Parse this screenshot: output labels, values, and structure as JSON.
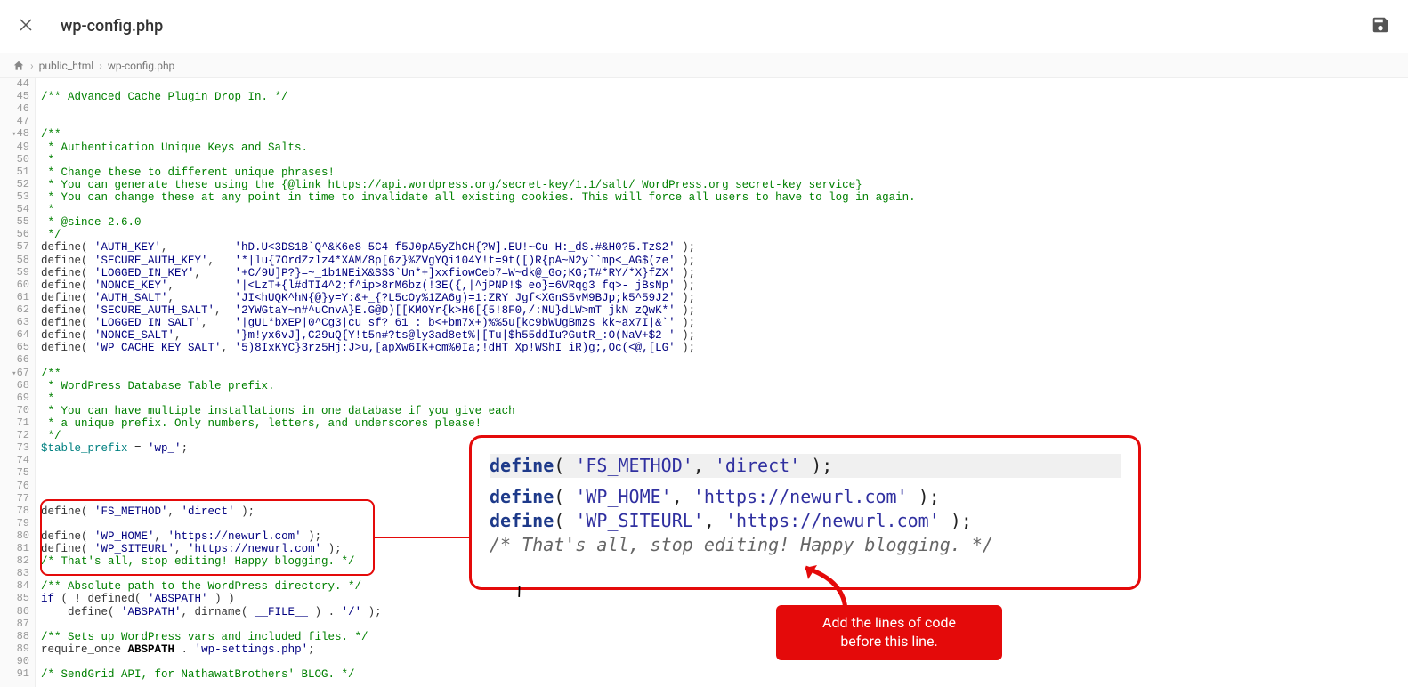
{
  "header": {
    "filename": "wp-config.php"
  },
  "breadcrumb": {
    "parts": [
      "public_html",
      "wp-config.php"
    ]
  },
  "first_line": 44,
  "code_lines": [
    {
      "type": "blank",
      "text": ""
    },
    {
      "type": "cm",
      "text": "/** Advanced Cache Plugin Drop In. */"
    },
    {
      "type": "blank",
      "text": ""
    },
    {
      "type": "blank",
      "text": ""
    },
    {
      "type": "cm",
      "text": "/**",
      "fold": true
    },
    {
      "type": "cm",
      "text": " * Authentication Unique Keys and Salts."
    },
    {
      "type": "cm",
      "text": " *"
    },
    {
      "type": "cm",
      "text": " * Change these to different unique phrases!"
    },
    {
      "type": "cm",
      "text": " * You can generate these using the {@link https://api.wordpress.org/secret-key/1.1/salt/ WordPress.org secret-key service}"
    },
    {
      "type": "cm",
      "text": " * You can change these at any point in time to invalidate all existing cookies. This will force all users to have to log in again."
    },
    {
      "type": "cm",
      "text": " *"
    },
    {
      "type": "cm",
      "text": " * @since 2.6.0"
    },
    {
      "type": "cm",
      "text": " */"
    },
    {
      "type": "def",
      "name": "AUTH_KEY",
      "pad": "         ",
      "val": "hD.U<3DS1B`Q^&K6e8-5C4 f5J0pA5yZhCH{?W].EU!~Cu H:_dS.#&H0?5.TzS2"
    },
    {
      "type": "def",
      "name": "SECURE_AUTH_KEY",
      "pad": "  ",
      "val": "*|lu{7OrdZzlz4*XAM/8p[6z}%ZVgYQi104Y!t=9t([)R{pA~N2y``mp<_AG$(ze"
    },
    {
      "type": "def",
      "name": "LOGGED_IN_KEY",
      "pad": "    ",
      "val": "+C/9U]P?}=~_1b1NEiX&SSS`Un*+]xxfiowCeb7=W~dk@_Go;KG;T#*RY/*X}fZX"
    },
    {
      "type": "def",
      "name": "NONCE_KEY",
      "pad": "        ",
      "val": "|<LzT+{l#dTI4^2;f^ip>8rM6bz(!3E({,|^jPNP!$ eo}=6VRqg3 fq>- jBsNp"
    },
    {
      "type": "def",
      "name": "AUTH_SALT",
      "pad": "        ",
      "val": "JI<hUQK^hN{@}y=Y:&+_{?L5cOy%1ZA6g)=1:ZRY Jgf<XGnS5vM9BJp;k5^59J2"
    },
    {
      "type": "def",
      "name": "SECURE_AUTH_SALT",
      "pad": " ",
      "val": "2YWGtaY~n#^uCnvA}E.G@D)[[KMOYr{k>H6[{5!8F0,/:NU}dLW>mT jkN zQwK*"
    },
    {
      "type": "def",
      "name": "LOGGED_IN_SALT",
      "pad": "   ",
      "val": "|gUL*bXEP|0^Cg3|cu sf?_61_: b<+bm7x+)%%5u[kc9bWUgBmzs_kk~ax7I|&`"
    },
    {
      "type": "def",
      "name": "NONCE_SALT",
      "pad": "       ",
      "val": "}m!yx6vJ],C29uQ{Y!t5n#?ts@ly3ad8et%|[Tu|$h55ddIu?GutR_:O(NaV+$2-"
    },
    {
      "type": "def",
      "name": "WP_CACHE_KEY_SALT",
      "pad": "",
      "val": "5)8IxKYC}3rz5Hj:J>u,[apXw6IK+cm%0Ia;!dHT Xp!WShI iR)g;,Oc(<@,[LG"
    },
    {
      "type": "blank",
      "text": ""
    },
    {
      "type": "cm",
      "text": "/**",
      "fold": true
    },
    {
      "type": "cm",
      "text": " * WordPress Database Table prefix."
    },
    {
      "type": "cm",
      "text": " *"
    },
    {
      "type": "cm",
      "text": " * You can have multiple installations in one database if you give each"
    },
    {
      "type": "cm",
      "text": " * a unique prefix. Only numbers, letters, and underscores please!"
    },
    {
      "type": "cm",
      "text": " */"
    },
    {
      "type": "assign",
      "var": "$table_prefix",
      "val": "wp_"
    },
    {
      "type": "blank",
      "text": ""
    },
    {
      "type": "blank",
      "text": ""
    },
    {
      "type": "blank",
      "text": ""
    },
    {
      "type": "blank",
      "text": ""
    },
    {
      "type": "defc",
      "name": "FS_METHOD",
      "val": "direct"
    },
    {
      "type": "blank",
      "text": ""
    },
    {
      "type": "defc",
      "name": "WP_HOME",
      "val": "https://newurl.com"
    },
    {
      "type": "defc",
      "name": "WP_SITEURL",
      "val": "https://newurl.com"
    },
    {
      "type": "cm",
      "text": "/* That's all, stop editing! Happy blogging. */"
    },
    {
      "type": "blank",
      "text": ""
    },
    {
      "type": "cm",
      "text": "/** Absolute path to the WordPress directory. */"
    },
    {
      "type": "raw",
      "html": "<span class='kw'>if</span> ( ! defined( <span class='str'>'ABSPATH'</span> ) )"
    },
    {
      "type": "raw",
      "html": "    define( <span class='str'>'ABSPATH'</span>, dirname( <span class='kw'>__FILE__</span> ) . <span class='str'>'/'</span> );"
    },
    {
      "type": "blank",
      "text": ""
    },
    {
      "type": "cm",
      "text": "/** Sets up WordPress vars and included files. */"
    },
    {
      "type": "raw",
      "html": "require_once <span class='bold'>ABSPATH</span> . <span class='str'>'wp-settings.php'</span>;"
    },
    {
      "type": "blank",
      "text": ""
    },
    {
      "type": "cm",
      "text": "/* SendGrid API, for NathawatBrothers' BLOG. */"
    }
  ],
  "callout": {
    "l1": "define( 'FS_METHOD', 'direct' );",
    "l2": "define( 'WP_HOME', 'https://newurl.com' );",
    "l3": "define( 'WP_SITEURL', 'https://newurl.com' );",
    "l4": "/* That's all, stop editing! Happy blogging. */"
  },
  "instruction": {
    "line1": "Add the lines of code",
    "line2": "before this line."
  }
}
